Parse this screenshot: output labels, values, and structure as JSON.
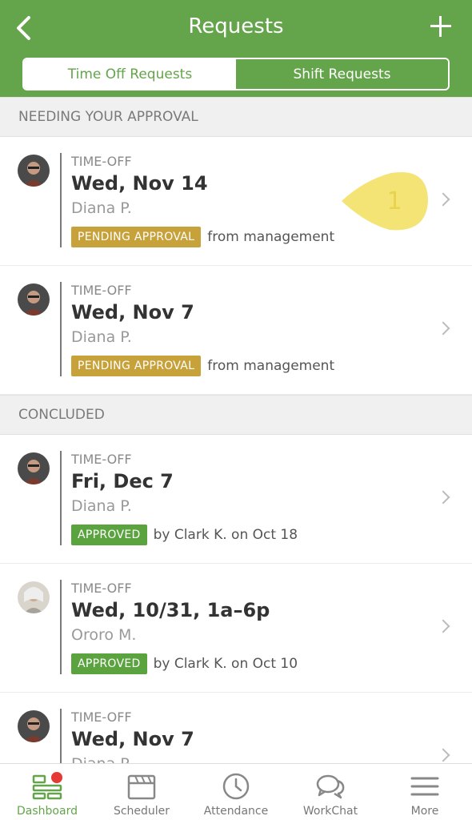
{
  "header": {
    "title": "Requests",
    "tabs": [
      {
        "label": "Time Off Requests",
        "active": true
      },
      {
        "label": "Shift Requests",
        "active": false
      }
    ]
  },
  "sections": {
    "approval": "NEEDING YOUR APPROVAL",
    "concluded": "CONCLUDED"
  },
  "requests": [
    {
      "type": "TIME-OFF",
      "date": "Wed, Nov 14",
      "person": "Diana P.",
      "status": "PENDING APPROVAL",
      "note": "from management"
    },
    {
      "type": "TIME-OFF",
      "date": "Wed, Nov 7",
      "person": "Diana P.",
      "status": "PENDING APPROVAL",
      "note": "from management"
    },
    {
      "type": "TIME-OFF",
      "date": "Fri, Dec 7",
      "person": "Diana P.",
      "status": "APPROVED",
      "note": "by Clark K. on Oct 18"
    },
    {
      "type": "TIME-OFF",
      "date": "Wed, 10/31, 1a–6p",
      "person": "Ororo M.",
      "status": "APPROVED",
      "note": "by Clark K. on Oct 10"
    },
    {
      "type": "TIME-OFF",
      "date": "Wed, Nov 7",
      "person": "Diana P.",
      "status": "",
      "note": ""
    }
  ],
  "annotation": {
    "label": "1"
  },
  "tabbar": [
    {
      "label": "Dashboard",
      "icon": "dashboard-icon",
      "active": true
    },
    {
      "label": "Scheduler",
      "icon": "calendar-icon",
      "active": false
    },
    {
      "label": "Attendance",
      "icon": "clock-icon",
      "active": false
    },
    {
      "label": "WorkChat",
      "icon": "chat-icon",
      "active": false
    },
    {
      "label": "More",
      "icon": "menu-icon",
      "active": false
    }
  ],
  "colors": {
    "brand": "#64a44b",
    "pending": "#c7a23a",
    "approved": "#5aa33f",
    "notification": "#e53935"
  }
}
